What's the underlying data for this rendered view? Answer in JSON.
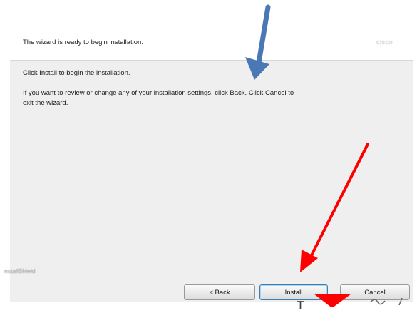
{
  "header": {
    "title": "The wizard is ready to begin installation.",
    "brand": "cisco"
  },
  "body": {
    "line1": "Click Install to begin the installation.",
    "line2": "If you want to review or change any of your installation settings, click Back. Click Cancel to",
    "line3": "exit the wizard."
  },
  "footer": {
    "installshield": "nstallShield",
    "back_label": "< Back",
    "install_label": "Install",
    "cancel_label": "Cancel"
  },
  "annotations": {
    "blue_arrow_color": "#4a78b5",
    "red_arrow_color": "#ff0000",
    "bottom_text": "T"
  }
}
